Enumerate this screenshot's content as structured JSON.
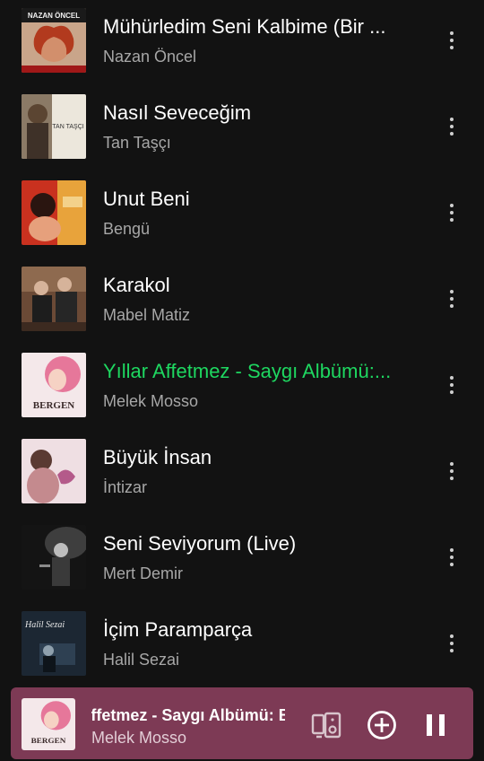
{
  "tracks": [
    {
      "title": "Mühürledim Seni Kalbime (Bir ...",
      "artist": "Nazan Öncel",
      "playing": false
    },
    {
      "title": "Nasıl Seveceğim",
      "artist": "Tan Taşçı",
      "playing": false
    },
    {
      "title": "Unut Beni",
      "artist": "Bengü",
      "playing": false
    },
    {
      "title": "Karakol",
      "artist": "Mabel Matiz",
      "playing": false
    },
    {
      "title": "Yıllar Affetmez - Saygı Albümü:...",
      "artist": "Melek Mosso",
      "playing": true
    },
    {
      "title": "Büyük İnsan",
      "artist": "İntizar",
      "playing": false
    },
    {
      "title": "Seni Seviyorum (Live)",
      "artist": "Mert Demir",
      "playing": false
    },
    {
      "title": "İçim Paramparça",
      "artist": "Halil Sezai",
      "playing": false
    }
  ],
  "covers": {
    "nazan_text": "NAZAN ÖNCEL",
    "tan_text": "TAN TAŞÇI",
    "bergen_text": "BERGEN",
    "halil_text": "Halil Sezai"
  },
  "mini_player": {
    "title": "Yıllar Affetmez - Saygı Albümü: Bergen",
    "artist": "Melek Mosso",
    "icons": [
      "devices-icon",
      "add-circle-icon",
      "pause-icon"
    ]
  },
  "colors": {
    "background": "#121212",
    "accent_green": "#1ed760",
    "mini_player_bg": "#7d3a55",
    "secondary_text": "#a7a7a7"
  }
}
